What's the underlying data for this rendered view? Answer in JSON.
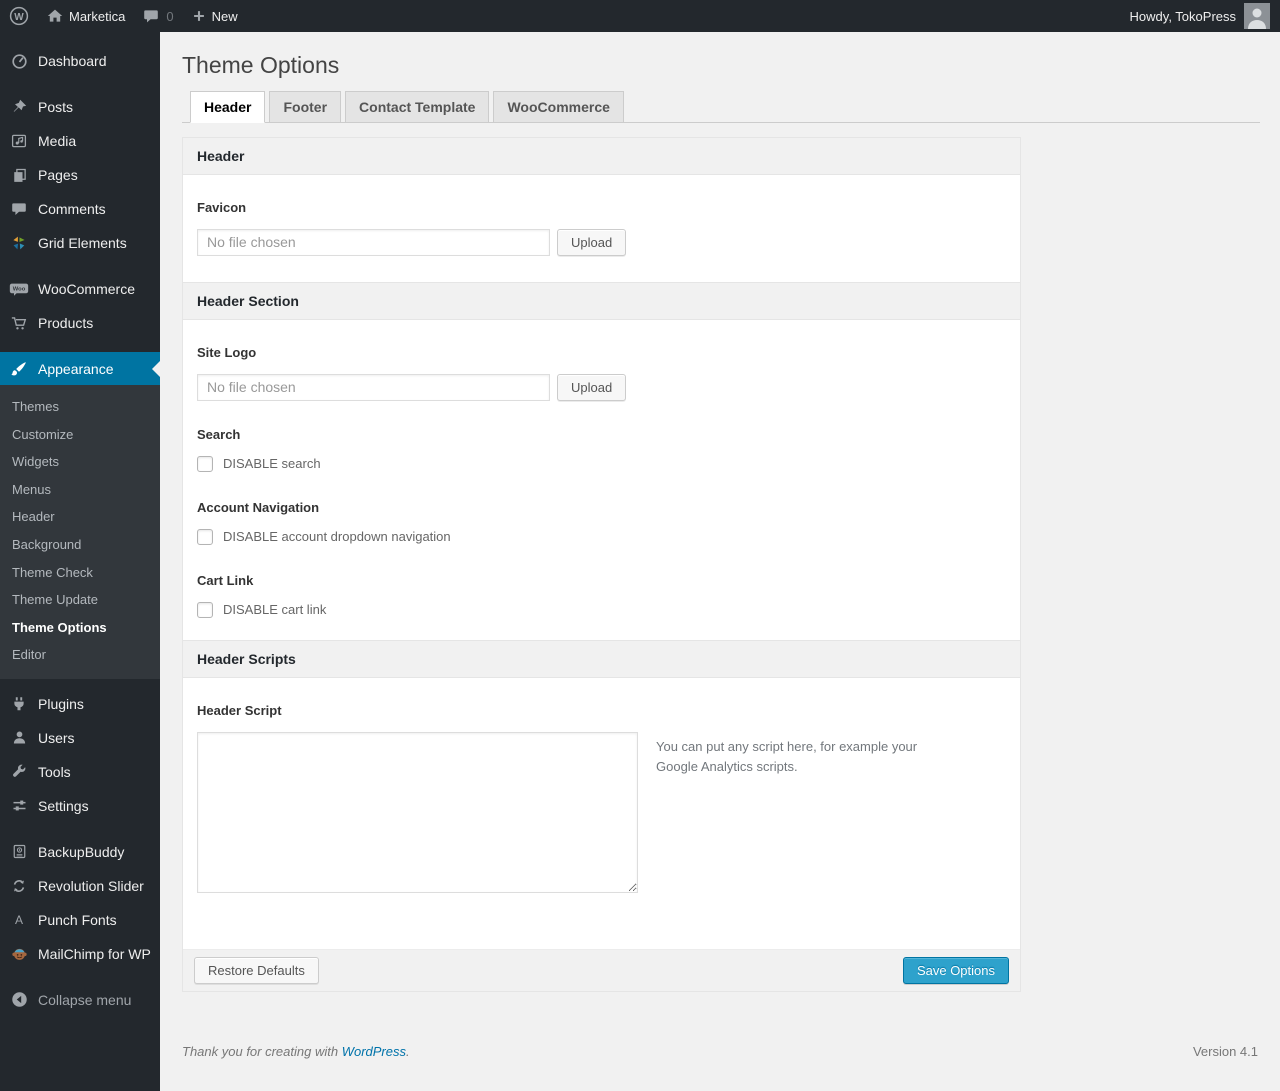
{
  "admin_bar": {
    "site_name": "Marketica",
    "comment_count": "0",
    "new_label": "New",
    "howdy": "Howdy, TokoPress"
  },
  "sidebar": {
    "items": [
      {
        "label": "Dashboard"
      },
      {
        "label": "Posts"
      },
      {
        "label": "Media"
      },
      {
        "label": "Pages"
      },
      {
        "label": "Comments"
      },
      {
        "label": "Grid Elements"
      },
      {
        "label": "WooCommerce"
      },
      {
        "label": "Products"
      },
      {
        "label": "Appearance"
      },
      {
        "label": "Plugins"
      },
      {
        "label": "Users"
      },
      {
        "label": "Tools"
      },
      {
        "label": "Settings"
      },
      {
        "label": "BackupBuddy"
      },
      {
        "label": "Revolution Slider"
      },
      {
        "label": "Punch Fonts"
      },
      {
        "label": "MailChimp for WP"
      },
      {
        "label": "Collapse menu"
      }
    ],
    "appearance_submenu": [
      {
        "label": "Themes"
      },
      {
        "label": "Customize"
      },
      {
        "label": "Widgets"
      },
      {
        "label": "Menus"
      },
      {
        "label": "Header"
      },
      {
        "label": "Background"
      },
      {
        "label": "Theme Check"
      },
      {
        "label": "Theme Update"
      },
      {
        "label": "Theme Options"
      },
      {
        "label": "Editor"
      }
    ]
  },
  "page": {
    "title": "Theme Options",
    "tabs": [
      {
        "label": "Header",
        "active": true
      },
      {
        "label": "Footer",
        "active": false
      },
      {
        "label": "Contact Template",
        "active": false
      },
      {
        "label": "WooCommerce",
        "active": false
      }
    ]
  },
  "panel": {
    "sections": {
      "header": "Header",
      "header_section": "Header Section",
      "header_scripts": "Header Scripts"
    },
    "favicon": {
      "label": "Favicon",
      "placeholder": "No file chosen",
      "upload_label": "Upload"
    },
    "site_logo": {
      "label": "Site Logo",
      "placeholder": "No file chosen",
      "upload_label": "Upload"
    },
    "search": {
      "label": "Search",
      "checkbox_label": "DISABLE search",
      "checked": false
    },
    "account_navigation": {
      "label": "Account Navigation",
      "checkbox_label": "DISABLE account dropdown navigation",
      "checked": false
    },
    "cart_link": {
      "label": "Cart Link",
      "checkbox_label": "DISABLE cart link",
      "checked": false
    },
    "header_script": {
      "label": "Header Script",
      "value": "",
      "help": "You can put any script here, for example your Google Analytics scripts."
    },
    "restore_label": "Restore Defaults",
    "save_label": "Save Options"
  },
  "footer": {
    "thanks_text": "Thank you for creating with",
    "wordpress_link": "WordPress",
    "period": ".",
    "version": "Version 4.1"
  },
  "colors": {
    "admin_bar_bg": "#23282d",
    "menu_bg": "#23282d",
    "submenu_bg": "#32373c",
    "menu_active_bg": "#0074a2",
    "primary_button_bg": "#2ea2cc",
    "link": "#0073aa",
    "page_bg": "#f1f1f1"
  }
}
